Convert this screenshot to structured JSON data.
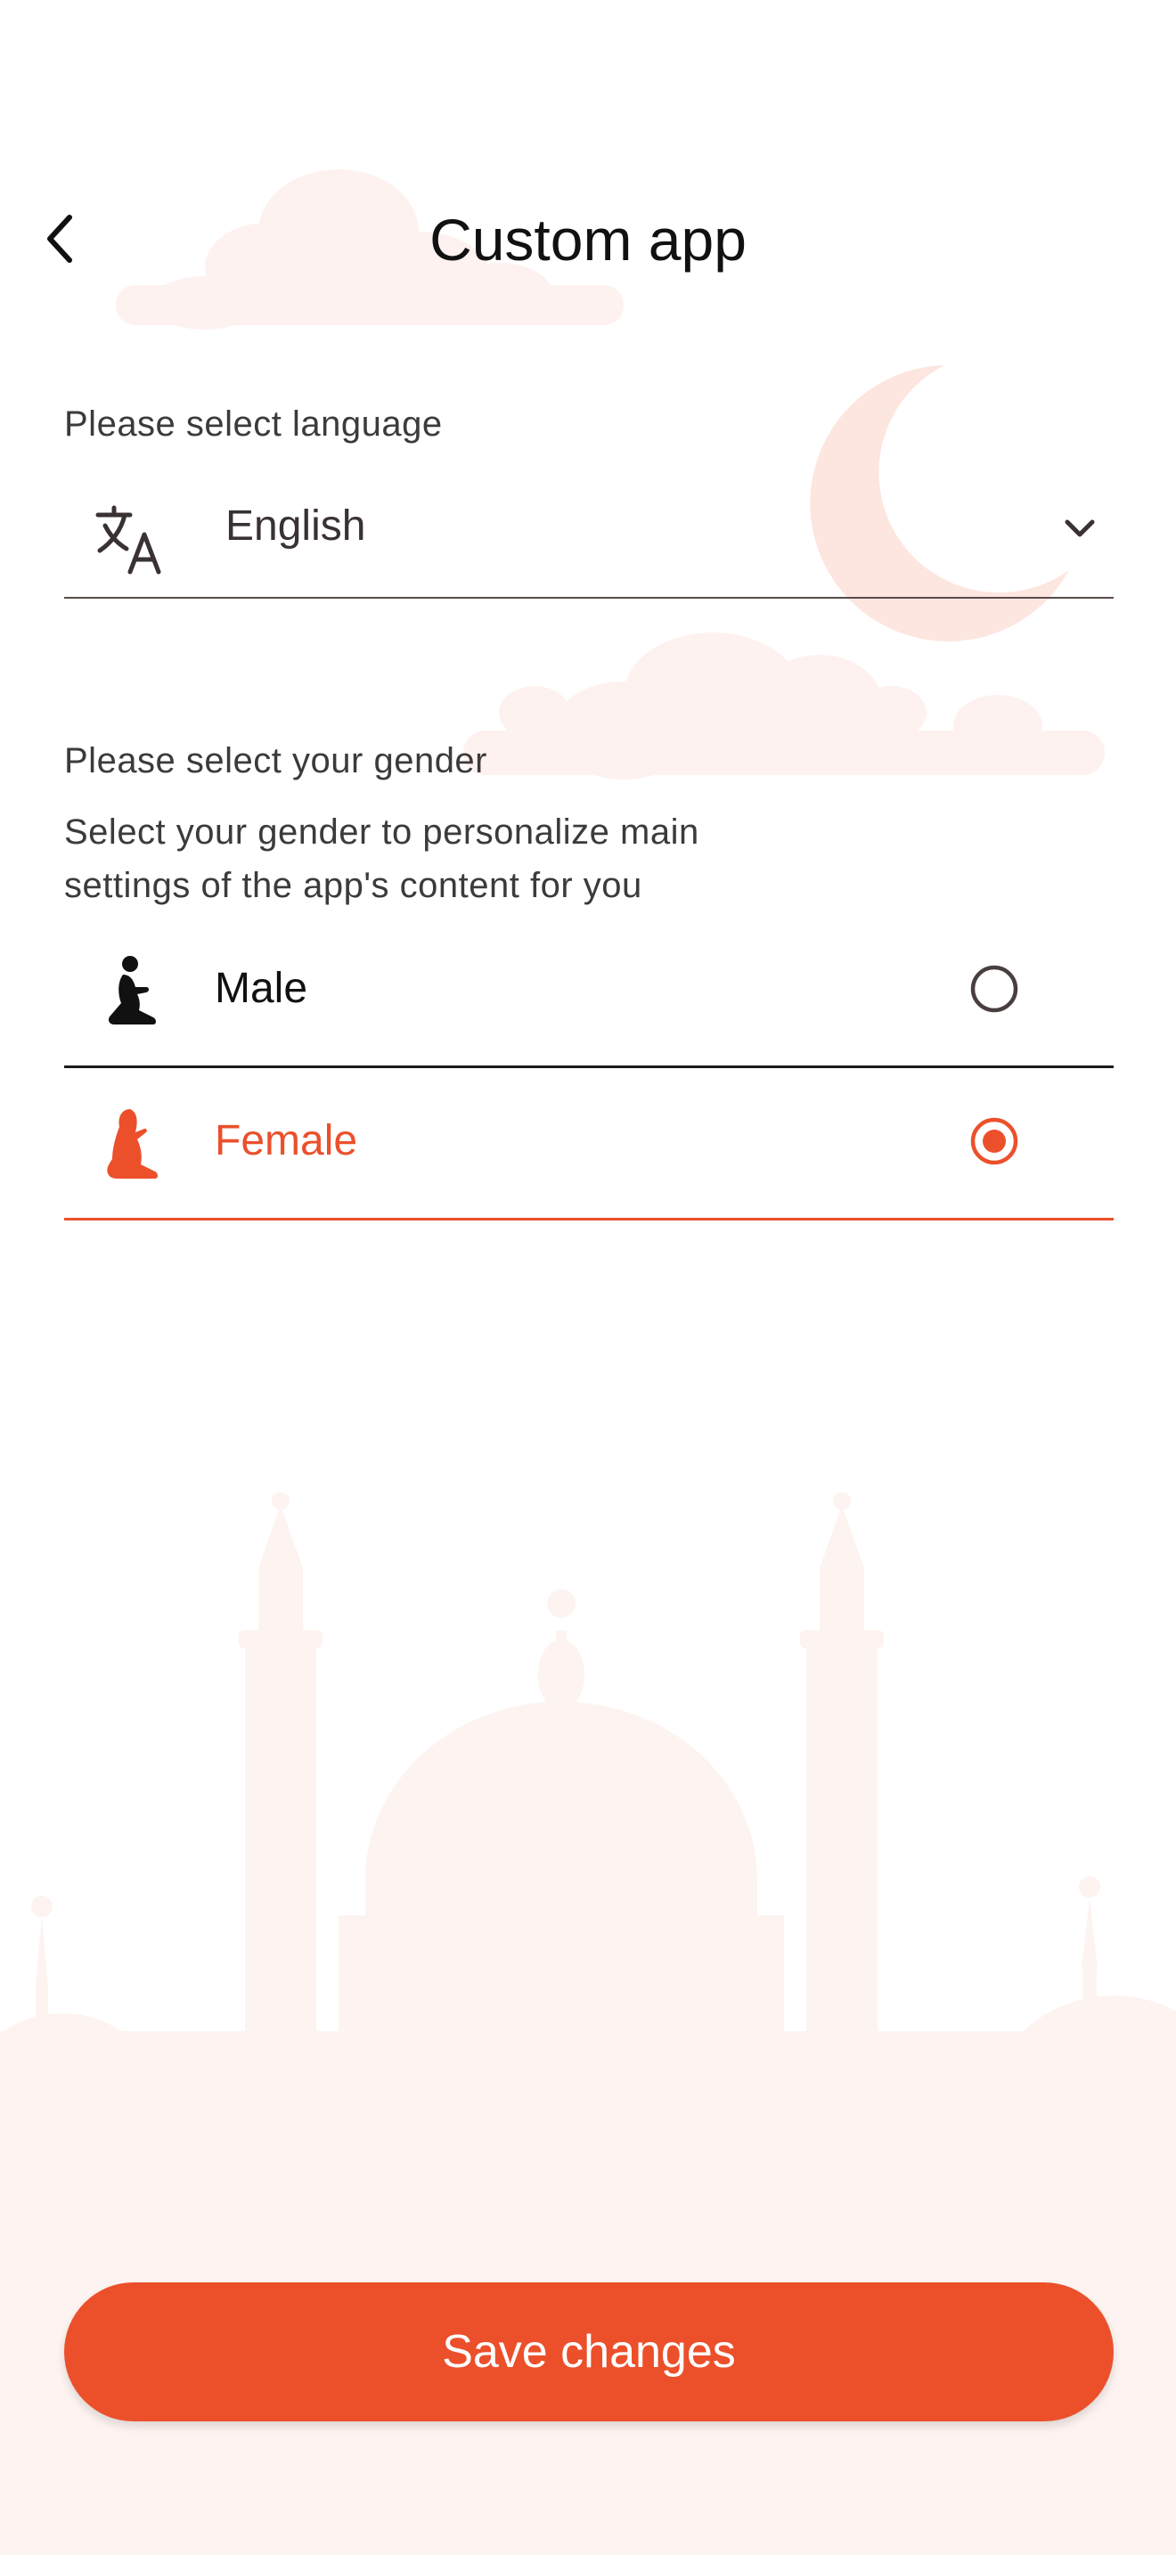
{
  "header": {
    "title": "Custom app",
    "back_icon": "chevron-left-icon"
  },
  "language": {
    "label": "Please select language",
    "selected": "English",
    "icon": "translate-icon",
    "dropdown_icon": "chevron-down-icon"
  },
  "gender": {
    "label": "Please select your gender",
    "description_line1": "Select your gender to personalize main",
    "description_line2": "settings of the app's content for you",
    "options": [
      {
        "label": "Male",
        "icon": "praying-man-icon",
        "selected": false
      },
      {
        "label": "Female",
        "icon": "praying-woman-icon",
        "selected": true
      }
    ]
  },
  "footer": {
    "save_label": "Save changes"
  },
  "colors": {
    "accent": "#EB502B",
    "text_primary": "#111111",
    "text_secondary": "#3B3B3B",
    "background_art": "#FDF1EE"
  }
}
